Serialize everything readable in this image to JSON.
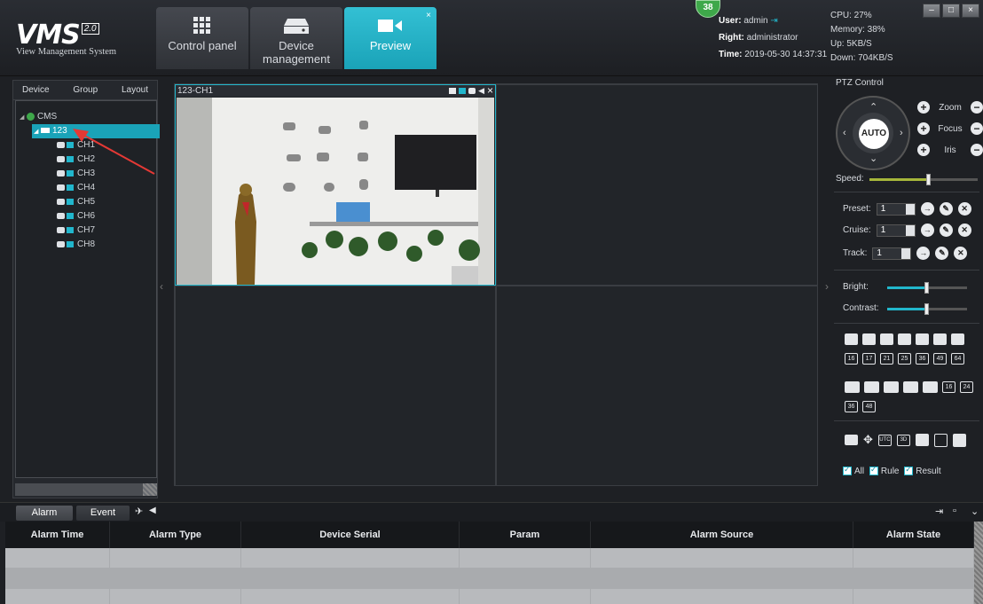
{
  "app": {
    "name": "VMS",
    "version": "2.0",
    "subtitle": "View Management System"
  },
  "nav": {
    "tabs": [
      {
        "label": "Control panel",
        "icon": "grid-icon"
      },
      {
        "label": "Device management",
        "icon": "device-icon"
      },
      {
        "label": "Preview",
        "icon": "video-camera-icon",
        "active": true,
        "close": "×"
      }
    ]
  },
  "status": {
    "badge": "38",
    "user_label": "User:",
    "user": "admin",
    "right_label": "Right:",
    "right": "administrator",
    "time_label": "Time:",
    "time": "2019-05-30 14:37:31",
    "cpu": "CPU: 27%",
    "memory": "Memory: 38%",
    "up": "Up: 5KB/S",
    "down": "Down: 704KB/S"
  },
  "window_controls": {
    "minimize": "–",
    "restore": "□",
    "close": "×"
  },
  "left": {
    "tabs": [
      "Device",
      "Group",
      "Layout"
    ],
    "tree": {
      "root": "CMS",
      "device": "123",
      "channels": [
        "CH1",
        "CH2",
        "CH3",
        "CH4",
        "CH5",
        "CH6",
        "CH7",
        "CH8"
      ]
    }
  },
  "video": {
    "cell1_title": "123-CH1",
    "close": "×"
  },
  "ptz": {
    "title": "PTZ Control",
    "auto": "AUTO",
    "zoom": "Zoom",
    "focus": "Focus",
    "iris": "Iris",
    "speed": "Speed:",
    "speed_level": 0.55,
    "preset": "Preset:",
    "preset_value": "1",
    "cruise": "Cruise:",
    "cruise_value": "1",
    "track": "Track:",
    "track_value": "1",
    "bright": "Bright:",
    "bright_level": 0.5,
    "contrast": "Contrast:",
    "contrast_level": 0.5,
    "layouts_numbered": [
      "16",
      "17",
      "21",
      "25",
      "36",
      "49",
      "64"
    ],
    "layouts_numbered2": [
      "16",
      "24"
    ],
    "layouts_numbered3": [
      "36",
      "48"
    ],
    "checks": [
      "All",
      "Rule",
      "Result"
    ]
  },
  "bottom": {
    "tabs": [
      "Alarm",
      "Event"
    ],
    "columns": [
      "Alarm Time",
      "Alarm Type",
      "Device Serial",
      "Param",
      "Alarm Source",
      "Alarm State"
    ]
  },
  "colors": {
    "accent": "#1aa3b8",
    "badge": "#3ea84a",
    "arrow": "#e53935"
  }
}
